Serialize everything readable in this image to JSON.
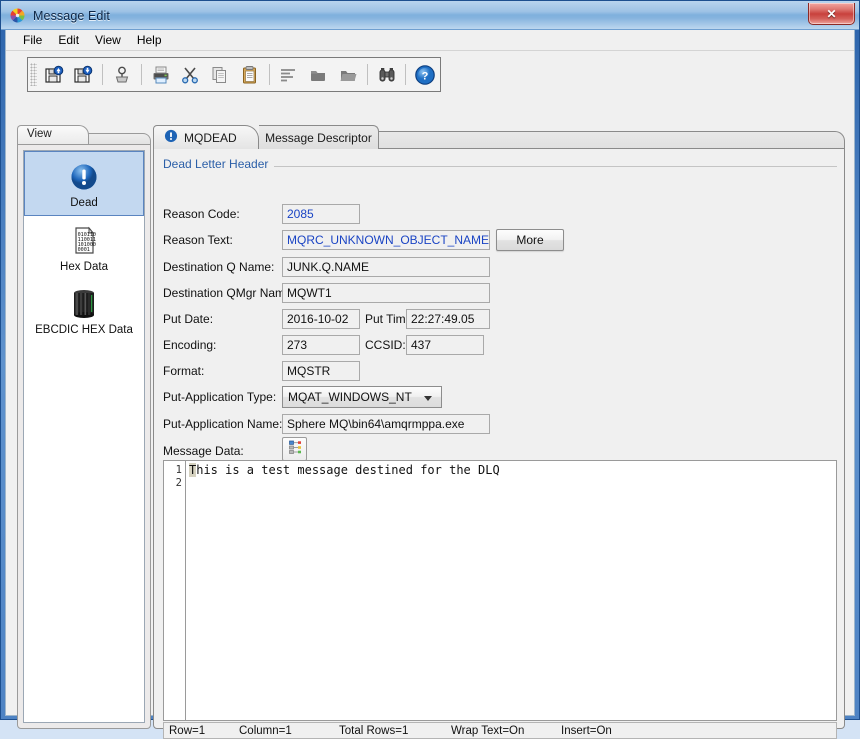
{
  "window": {
    "title": "Message Edit",
    "app_icon": "pinwheel-icon",
    "close_label": "✕"
  },
  "menubar": {
    "items": [
      {
        "label": "File"
      },
      {
        "label": "Edit"
      },
      {
        "label": "View"
      },
      {
        "label": "Help"
      }
    ]
  },
  "toolbar": {
    "buttons": [
      {
        "name": "save-up-icon",
        "title": "Load Message"
      },
      {
        "name": "save-down-icon",
        "title": "Save Message"
      },
      {
        "name": "search-pop-icon",
        "title": "Browse"
      },
      {
        "name": "print-icon",
        "title": "Print"
      },
      {
        "name": "cut-scissors-icon",
        "title": "Cut"
      },
      {
        "name": "copy-icon",
        "title": "Copy"
      },
      {
        "name": "paste-clipboard-icon",
        "title": "Paste"
      },
      {
        "name": "align-left-icon",
        "title": "Format"
      },
      {
        "name": "folder-dark-icon",
        "title": "Open Folder"
      },
      {
        "name": "folder-open-dark-icon",
        "title": "Open Folder 2"
      },
      {
        "name": "binoculars-icon",
        "title": "Find"
      },
      {
        "name": "help-question-icon",
        "title": "Help"
      }
    ]
  },
  "sidebar": {
    "tab_label": "View",
    "items": [
      {
        "label": "Dead",
        "icon": "exclamation-circle-icon",
        "selected": true
      },
      {
        "label": "Hex Data",
        "icon": "binary-document-icon",
        "selected": false
      },
      {
        "label": "EBCDIC HEX Data",
        "icon": "mainframe-server-icon",
        "selected": false
      }
    ]
  },
  "tabs": [
    {
      "label": "MQDEAD",
      "icon": "exclamation-circle-icon",
      "active": true
    },
    {
      "label": "Message Descriptor",
      "icon": "",
      "active": false
    }
  ],
  "form": {
    "group_title": "Dead Letter Header",
    "fields": {
      "reason_code": {
        "label": "Reason Code:",
        "value": "2085"
      },
      "reason_text": {
        "label": "Reason Text:",
        "value": "MQRC_UNKNOWN_OBJECT_NAME"
      },
      "more_button": {
        "label": "More"
      },
      "destination_q_name": {
        "label": "Destination Q Name:",
        "value": "JUNK.Q.NAME"
      },
      "destination_qmgr_name": {
        "label": "Destination QMgr Name:",
        "value": "MQWT1"
      },
      "put_date": {
        "label": "Put Date:",
        "value": "2016-10-02"
      },
      "put_time": {
        "label": "Put Time:",
        "value": "22:27:49.05"
      },
      "encoding": {
        "label": "Encoding:",
        "value": "273"
      },
      "ccsid": {
        "label": "CCSID:",
        "value": "437"
      },
      "format": {
        "label": "Format:",
        "value": "MQSTR"
      },
      "put_application_type": {
        "label": "Put-Application Type:",
        "value": "MQAT_WINDOWS_NT"
      },
      "put_application_name": {
        "label": "Put-Application Name:",
        "value": "Sphere MQ\\bin64\\amqrmppa.exe"
      },
      "message_data": {
        "label": "Message Data:",
        "button_icon": "message-data-tree-icon"
      }
    }
  },
  "editor": {
    "line_numbers": "1\n2",
    "first_char": "T",
    "rest_text": "his is a test message destined for the DLQ"
  },
  "statusbar": {
    "row": "Row=1",
    "column": "Column=1",
    "total_rows": "Total Rows=1",
    "wrap_text": "Wrap Text=On",
    "insert": "Insert=On"
  },
  "colors": {
    "accent_blue": "#2b5fa8",
    "field_blue_text": "#1a44c4",
    "selection_blue": "#c3d8f0",
    "titlebar_blue": "#7fb0dd",
    "close_red": "#c8413c"
  }
}
